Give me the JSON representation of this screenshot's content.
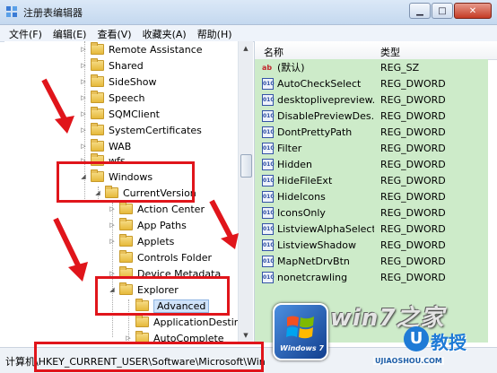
{
  "window": {
    "title": "注册表编辑器",
    "buttons": {
      "minimize": "▁",
      "maximize": "□",
      "close": "✕"
    }
  },
  "menu": [
    "文件(F)",
    "编辑(E)",
    "查看(V)",
    "收藏夹(A)",
    "帮助(H)"
  ],
  "tree": {
    "items": [
      {
        "label": "Remote Assistance",
        "expander": "▷"
      },
      {
        "label": "Shared",
        "expander": "▷"
      },
      {
        "label": "SideShow",
        "expander": "▷"
      },
      {
        "label": "Speech",
        "expander": "▷"
      },
      {
        "label": "SQMClient",
        "expander": "▷"
      },
      {
        "label": "SystemCertificates",
        "expander": "▷"
      },
      {
        "label": "WAB",
        "expander": "▷"
      },
      {
        "label": "wfs",
        "expander": "▷"
      },
      {
        "label": "Windows",
        "expander": "◢"
      },
      {
        "label": "CurrentVersion",
        "expander": "◢"
      },
      {
        "label": "Action Center",
        "expander": "▷"
      },
      {
        "label": "App Paths",
        "expander": "▷"
      },
      {
        "label": "Applets",
        "expander": "▷"
      },
      {
        "label": "Controls Folder",
        "expander": ""
      },
      {
        "label": "Device Metadata",
        "expander": "▷"
      },
      {
        "label": "Explorer",
        "expander": "◢"
      },
      {
        "label": "Advanced",
        "expander": ""
      },
      {
        "label": "ApplicationDestinations",
        "expander": ""
      },
      {
        "label": "AutoComplete",
        "expander": "▷"
      }
    ]
  },
  "values_pane": {
    "col_name": "名称",
    "col_type": "类型",
    "rows": [
      {
        "icon": "ab",
        "name": "(默认)",
        "type": "REG_SZ"
      },
      {
        "icon": "dw",
        "name": "AutoCheckSelect",
        "type": "REG_DWORD"
      },
      {
        "icon": "dw",
        "name": "desktoplivepreview...",
        "type": "REG_DWORD"
      },
      {
        "icon": "dw",
        "name": "DisablePreviewDes...",
        "type": "REG_DWORD"
      },
      {
        "icon": "dw",
        "name": "DontPrettyPath",
        "type": "REG_DWORD"
      },
      {
        "icon": "dw",
        "name": "Filter",
        "type": "REG_DWORD"
      },
      {
        "icon": "dw",
        "name": "Hidden",
        "type": "REG_DWORD"
      },
      {
        "icon": "dw",
        "name": "HideFileExt",
        "type": "REG_DWORD"
      },
      {
        "icon": "dw",
        "name": "HideIcons",
        "type": "REG_DWORD"
      },
      {
        "icon": "dw",
        "name": "IconsOnly",
        "type": "REG_DWORD"
      },
      {
        "icon": "dw",
        "name": "ListviewAlphaSelect",
        "type": "REG_DWORD"
      },
      {
        "icon": "dw",
        "name": "ListviewShadow",
        "type": "REG_DWORD"
      },
      {
        "icon": "dw",
        "name": "MapNetDrvBtn",
        "type": "REG_DWORD"
      },
      {
        "icon": "dw",
        "name": "nonetcrawling",
        "type": "REG_DWORD"
      }
    ]
  },
  "status": {
    "text": "计算机\\HKEY_CURRENT_USER\\Software\\Microsoft\\Windows\\CurrentVersion\\Explorer\\Advanced"
  },
  "watermark": {
    "title": "win7之家",
    "logo_text": "Windows 7",
    "u_letter": "U",
    "brand": "教授",
    "url": "UJIAOSHOU.COM"
  },
  "colors": {
    "highlight": "#e0151b",
    "values_bg": "#cdebc9",
    "selected": "#cfe3fa"
  }
}
